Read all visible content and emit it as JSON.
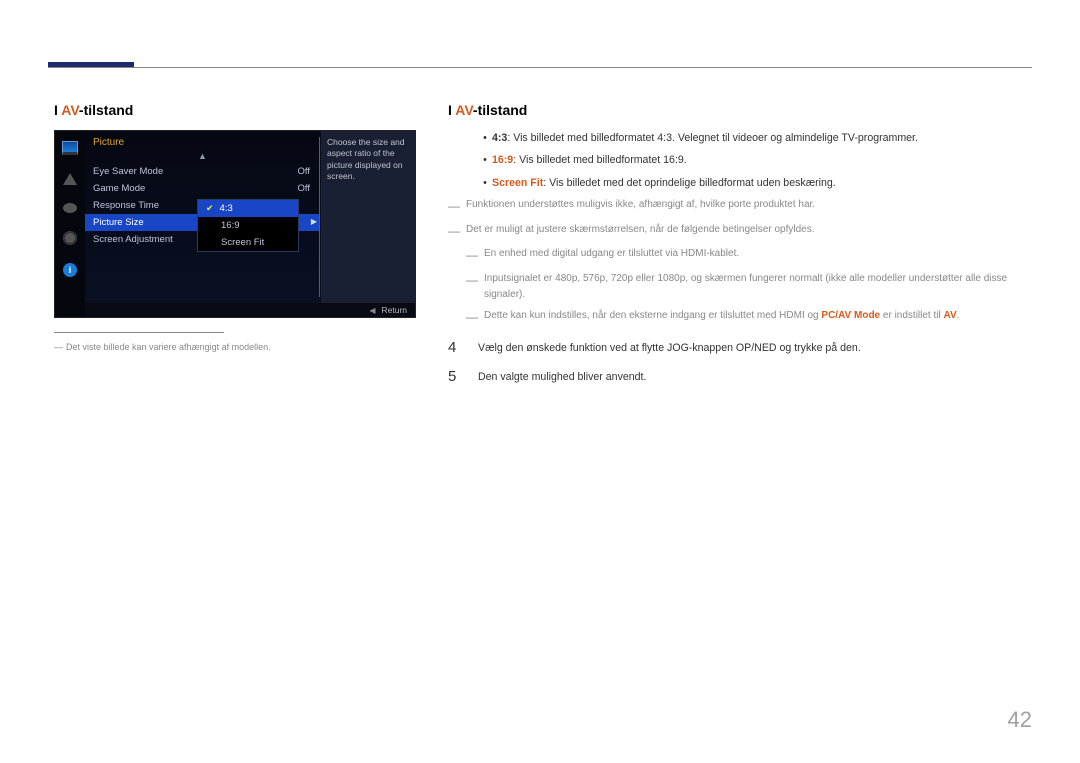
{
  "page_number": "42",
  "section_title_left": "I ",
  "section_title_av": "AV",
  "section_title_rest": "-tilstand",
  "osd": {
    "title": "Picture",
    "items": [
      {
        "label": "Eye Saver Mode",
        "value": "Off"
      },
      {
        "label": "Game Mode",
        "value": "Off"
      },
      {
        "label": "Response Time",
        "value": ""
      },
      {
        "label": "Picture Size",
        "value": ""
      },
      {
        "label": "Screen Adjustment",
        "value": ""
      }
    ],
    "popup": [
      "4:3",
      "16:9",
      "Screen Fit"
    ],
    "help_text": "Choose the size and aspect ratio of the picture displayed on screen.",
    "return_label": "Return"
  },
  "footnote_under_image": "Det viste billede kan variere afhængigt af modellen.",
  "bullets": [
    {
      "label": "4:3",
      "text": ": Vis billedet med billedformatet 4:3. Velegnet til videoer og almindelige TV-programmer."
    },
    {
      "label": "16:9",
      "text": ": Vis billedet med billedformatet 16:9."
    },
    {
      "label": "Screen Fit",
      "text": ": Vis billedet med det oprindelige billedformat uden beskæring."
    }
  ],
  "notes_top": [
    "Funktionen understøttes muligvis ikke, afhængigt af, hvilke porte produktet har.",
    "Det er muligt at justere skærmstørrelsen, når de følgende betingelser opfyldes."
  ],
  "notes_sub": [
    "En enhed med digital udgang er tilsluttet via HDMI-kablet.",
    "Inputsignalet er 480p, 576p, 720p eller 1080p, og skærmen fungerer normalt (ikke alle modeller understøtter alle disse signaler)."
  ],
  "notes_tail_pre": "Dette kan kun indstilles, når den eksterne indgang er tilsluttet med HDMI og ",
  "notes_tail_mode": "PC/AV Mode",
  "notes_tail_mid": " er indstillet til ",
  "notes_tail_av": "AV",
  "notes_tail_end": ".",
  "steps": [
    {
      "num": "4",
      "text": "Vælg den ønskede funktion ved at flytte JOG-knappen OP/NED og trykke på den."
    },
    {
      "num": "5",
      "text": "Den valgte mulighed bliver anvendt."
    }
  ]
}
